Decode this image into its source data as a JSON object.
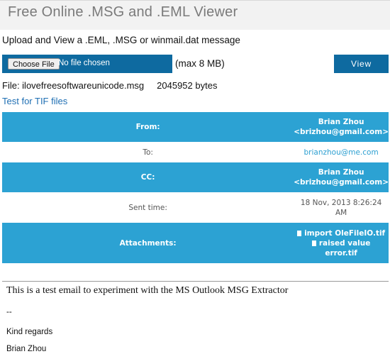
{
  "page": {
    "title": "Free Online .MSG and .EML Viewer"
  },
  "upload": {
    "intro": "Upload and View a .EML, .MSG or winmail.dat message",
    "choose_label": "Choose File",
    "no_file_text": "No file chosen",
    "max_size": "(max 8 MB)",
    "view_label": "View"
  },
  "file_info": {
    "name": "File: ilovefreesoftwareunicode.msg",
    "size": "2045952 bytes",
    "tif_link": "Test for TIF files"
  },
  "headers": {
    "from": {
      "label": "From:",
      "name": "Brian Zhou",
      "email": "<brizhou@gmail.com>"
    },
    "to": {
      "label": "To:",
      "value": "brianzhou@me.com"
    },
    "cc": {
      "label": "CC:",
      "name": "Brian Zhou",
      "email": "<brizhou@gmail.com>"
    },
    "sent": {
      "label": "Sent time:",
      "line1": "18 Nov, 2013 8:26:24",
      "line2": "AM"
    },
    "attachments": {
      "label": "Attachments:",
      "items": [
        {
          "line1": "import OleFileIO.tif",
          "line2": ""
        },
        {
          "line1": "raised value",
          "line2": "error.tif"
        }
      ]
    }
  },
  "message": {
    "line1": "This is a test email to experiment with the MS Outlook MSG Extractor",
    "line2": "--",
    "line3": "Kind regards",
    "line4": "Brian Zhou"
  },
  "colors": {
    "accent_dark": "#0e6aa0",
    "accent_light": "#2ca2d3",
    "link": "#1f6fb3"
  }
}
